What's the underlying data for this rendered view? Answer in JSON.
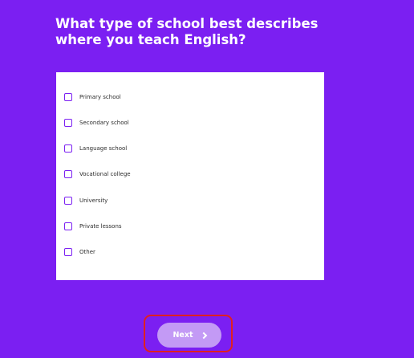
{
  "question": {
    "title": "What type of school best describes where you teach English?"
  },
  "options": [
    {
      "label": "Primary school",
      "checked": false
    },
    {
      "label": "Secondary school",
      "checked": false
    },
    {
      "label": "Language school",
      "checked": false
    },
    {
      "label": "Vocational college",
      "checked": false
    },
    {
      "label": "University",
      "checked": false
    },
    {
      "label": "Private lessons",
      "checked": false
    },
    {
      "label": "Other",
      "checked": false
    }
  ],
  "footer": {
    "next_label": "Next",
    "next_icon": "chevron-right-icon"
  },
  "colors": {
    "background": "#7b1ff2",
    "card": "#ffffff",
    "checkbox_border": "#7b1ff2",
    "next_button": "#c39af5",
    "highlight": "#e02020"
  }
}
